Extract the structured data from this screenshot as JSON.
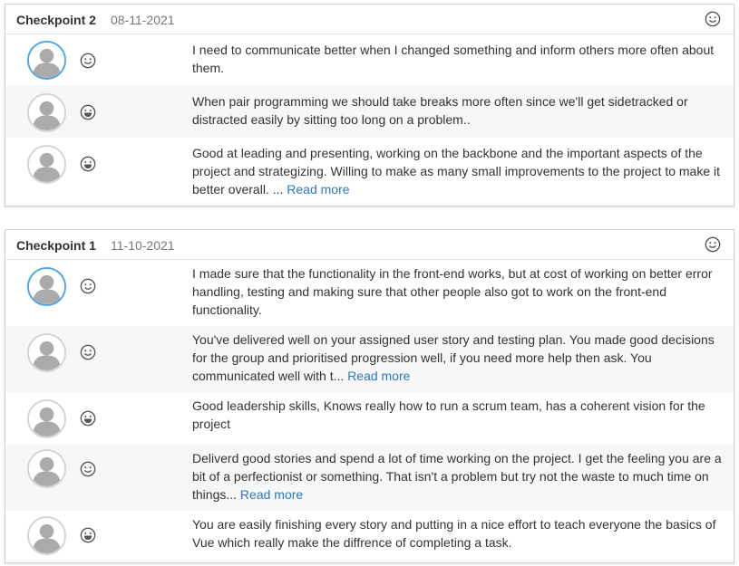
{
  "checkpoints": [
    {
      "title": "Checkpoint 2",
      "date": "08-11-2021",
      "feedback": [
        {
          "text": "I need to communicate better when I changed something and inform others more often about them.",
          "read_more": ""
        },
        {
          "text": "When pair programming we should take breaks more often since we'll get sidetracked or distracted easily by sitting too long on a problem..",
          "read_more": ""
        },
        {
          "text": "Good at leading and presenting, working on the backbone and the important aspects of the project and strategizing. Willing to make as many small improvements to the project to make it better overall. ...",
          "read_more": "Read more"
        }
      ]
    },
    {
      "title": "Checkpoint 1",
      "date": "11-10-2021",
      "feedback": [
        {
          "text": "I made sure that the functionality in the front-end works, but at cost of working on better error handling, testing and making sure that other people also got to work on the front-end functionality.",
          "read_more": ""
        },
        {
          "text": "You've delivered well on your assigned user story and testing plan. You made good decisions for the group and prioritised progression well, if you need more help then ask. You communicated well with t...",
          "read_more": "Read more"
        },
        {
          "text": "Good leadership skills, Knows really how to run a scrum team, has a coherent vision for the project",
          "read_more": ""
        },
        {
          "text": "Deliverd good stories and spend a lot of time working on the project. I get the feeling you are a bit of a perfectionist or something. That isn't a problem but try not the waste to much time on things...",
          "read_more": "Read more"
        },
        {
          "text": "You are easily finishing every story and putting in a nice effort to teach everyone the basics of Vue which really make the diffrence of completing a task.",
          "read_more": ""
        }
      ]
    }
  ],
  "colors": {
    "link": "#2a78c2",
    "active_avatar_border": "#4fa6e6",
    "row_alt_background": "#f7f7f7",
    "date_text": "#777777"
  },
  "icons": {
    "header": "smiley-outline-icon",
    "mood_outline": "smiley-outline-icon",
    "mood_filled": "smiley-grin-icon",
    "avatar": "default-user-avatar"
  }
}
